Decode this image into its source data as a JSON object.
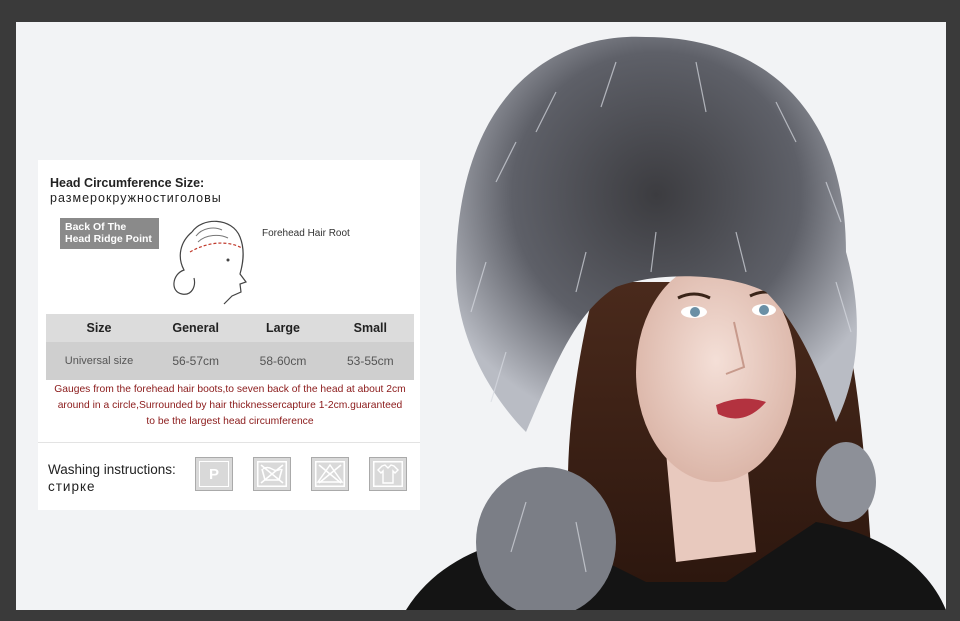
{
  "size_chart": {
    "title": "Head Circumference Size:",
    "title_ru": "размерокружностиголовы",
    "back_label": "Back Of The Head Ridge Point",
    "forehead_label": "Forehead Hair Root",
    "headers": [
      "Size",
      "General",
      "Large",
      "Small"
    ],
    "row": [
      "Universal size",
      "56-57cm",
      "58-60cm",
      "53-55cm"
    ],
    "gauge_text": "Gauges from the forehead hair boots,to seven back of the head at about 2cm around in a circle,Surrounded by hair thicknessercapture 1-2cm.guaranteed to be the largest head circumference"
  },
  "washing": {
    "label": "Washing instructions:",
    "label_ru": "стирке",
    "icons": [
      "dry-clean-p-icon",
      "no-washing-icon",
      "no-bleach-icon",
      "do-not-tumble-dry-icon"
    ],
    "p_letter": "P"
  },
  "colors": {
    "background": "#f2f3f5",
    "frame": "#3a3a3a",
    "gauge_text": "#8b1a1a"
  }
}
